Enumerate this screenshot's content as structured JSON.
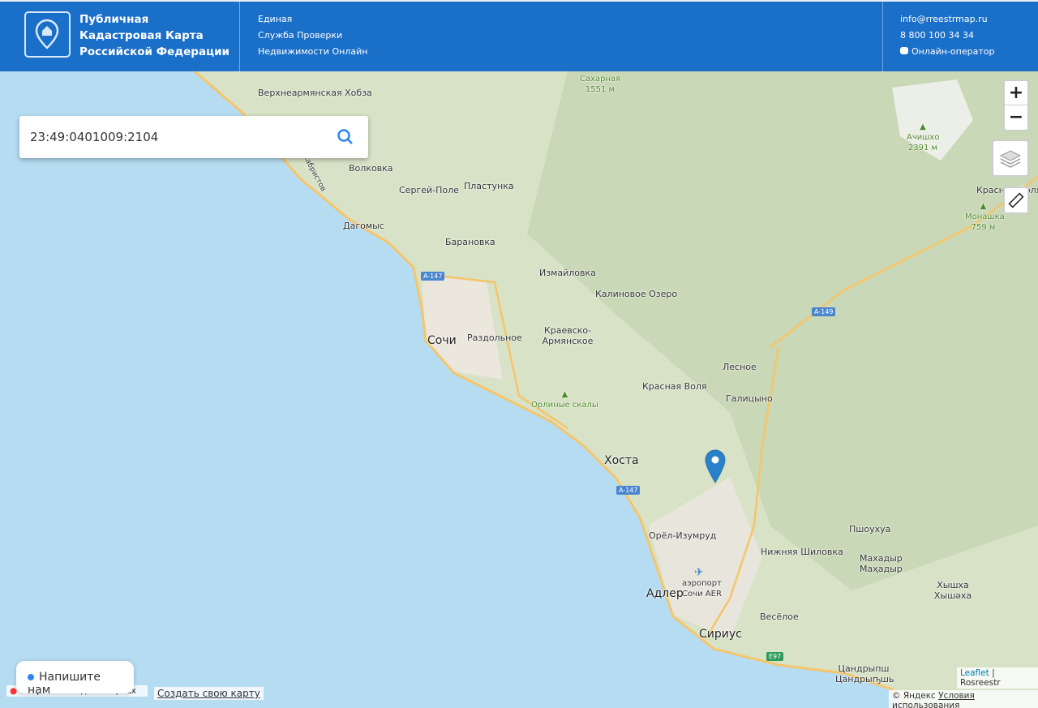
{
  "header": {
    "brand": [
      "Публичная",
      "Кадастровая Карта",
      "Российской Федерации"
    ],
    "subtitle": [
      "Единая",
      "Служба Проверки",
      "Недвижимости Онлайн"
    ],
    "email": "info@rreestrmap.ru",
    "phone": "8 800 100 34 34",
    "operator": "Онлайн-оператор"
  },
  "search": {
    "value": "23:49:0401009:2104"
  },
  "controls": {
    "zoom_in": "+",
    "zoom_out": "−"
  },
  "map": {
    "places": [
      "Верхнеармянская Хобза",
      "Волковка",
      "Сергей-Поле",
      "Пластунка",
      "Дагомыс",
      "Барановка",
      "Измайловка",
      "Калиновое Озеро",
      "Сочи",
      "Раздольное",
      "Краевско-Армянское",
      "Лесное",
      "Красная Воля",
      "Галицыно",
      "Хоста",
      "Орёл-Изумруд",
      "Нижняя Шиловка",
      "Пшоухуа",
      "Махадыр Маҳадыр",
      "Хышха Хышәха",
      "аэропорт Сочи AER",
      "Адлер",
      "Весёлое",
      "Сириус",
      "Цандрыпш Цандрыҧшь",
      "Красная Поляна",
      "улица Декабристов"
    ],
    "peaks": [
      "Сахарная 1551 м",
      "Ачишхо 2391 м",
      "Монашка 759 м",
      "Орлиные скалы"
    ],
    "roads": [
      "A-147",
      "A-149",
      "A-147",
      "E97"
    ]
  },
  "chat": {
    "label": "Напишите нам"
  },
  "footer": {
    "yandex_open": "Открыть в Яндекс.Картах",
    "create_map": "Создать свою карту",
    "leaflet": "Leaflet",
    "rosreestr": "Rosreestr",
    "copyright": "© Яндекс",
    "terms": "Условия использования"
  }
}
